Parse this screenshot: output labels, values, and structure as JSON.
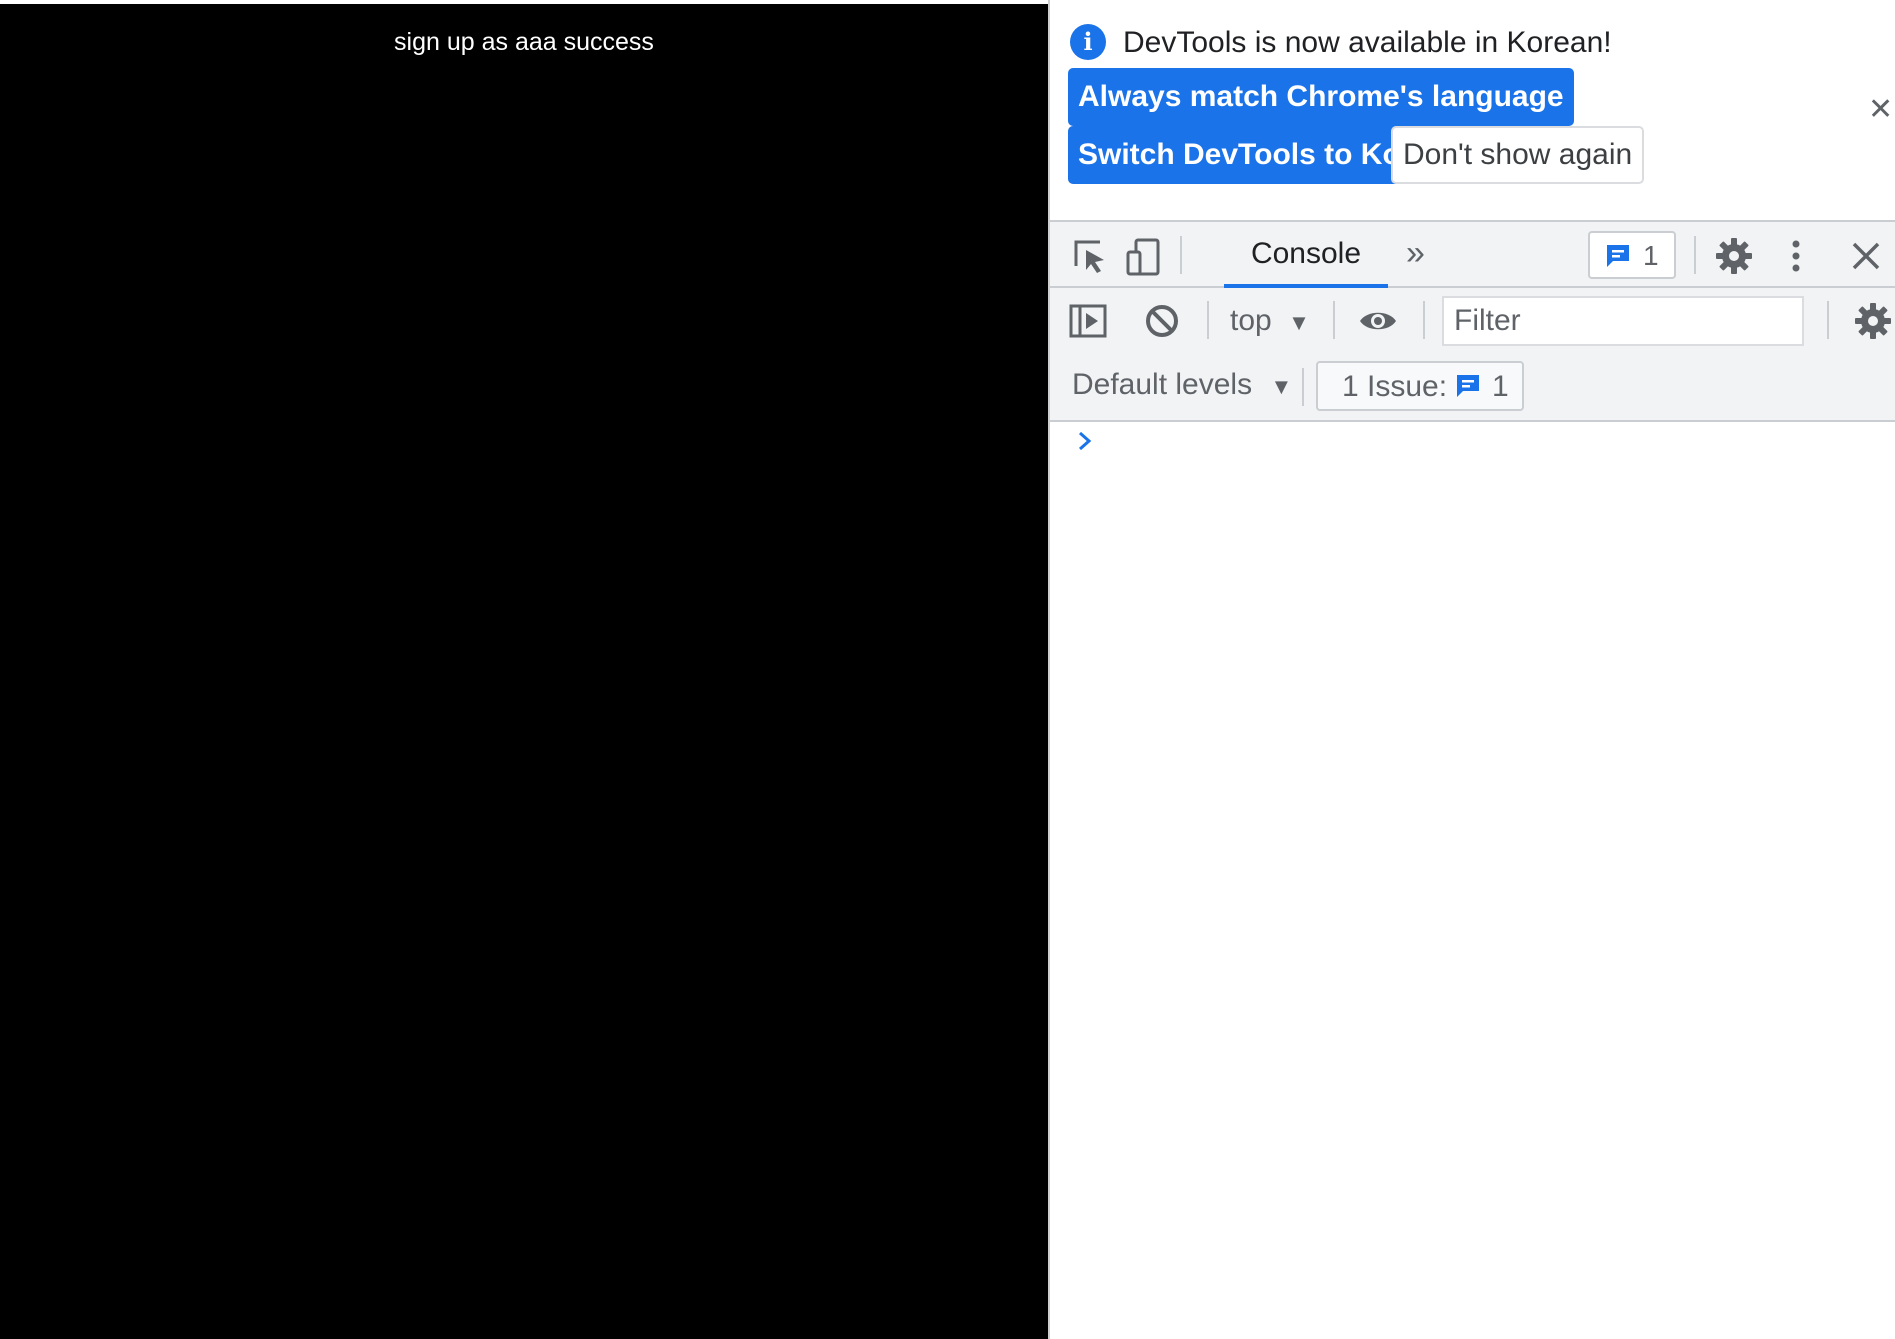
{
  "page": {
    "message": "sign up as aaa success"
  },
  "devtools": {
    "infobar": {
      "message": "DevTools is now available in Korean!",
      "always_match_button": "Always match Chrome's language",
      "switch_button": "Switch DevTools to Korean",
      "dont_show_button": "Don't show again",
      "info_icon_glyph": "i",
      "close_glyph": "✕"
    },
    "toolbar": {
      "console_tab": "Console",
      "more_tabs_glyph": "»",
      "issues_count": "1",
      "close_glyph": "✕",
      "icons": [
        "inspect-element-icon",
        "device-toolbar-icon",
        "more-tabs-icon",
        "issues-icon",
        "settings-icon",
        "kebab-menu-icon",
        "close-icon"
      ]
    },
    "console_toolbar": {
      "context": "top",
      "filter_placeholder": "Filter",
      "levels": "Default levels",
      "issue_label": "1 Issue:",
      "issue_count": "1",
      "icons": [
        "sidebar-toggle-icon",
        "clear-console-icon",
        "live-expression-eye-icon",
        "console-settings-icon"
      ]
    },
    "colors": {
      "accent": "#1a73e8",
      "toolbar_bg": "#f1f3f4",
      "page_bg": "#000000"
    }
  }
}
